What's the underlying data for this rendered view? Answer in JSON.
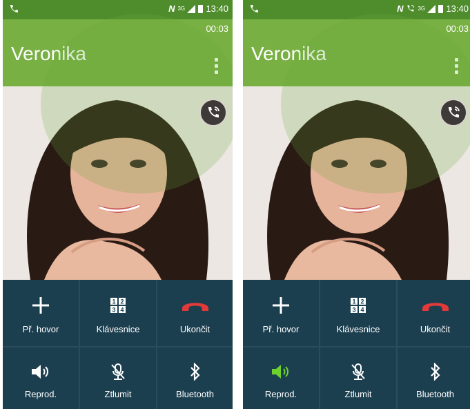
{
  "screens": [
    {
      "status": {
        "time": "13:40",
        "nfc": "N",
        "network": "3G"
      },
      "contact_name": "Veronika",
      "call_timer": "00:03",
      "buttons": {
        "add_call": "Př. hovor",
        "keypad": "Klávesnice",
        "end_call": "Ukončit",
        "speaker": "Reprod.",
        "mute": "Ztlumit",
        "bluetooth": "Bluetooth"
      },
      "speaker_on": false
    },
    {
      "status": {
        "time": "13:40",
        "nfc": "N",
        "network": "3G"
      },
      "contact_name": "Veronika",
      "call_timer": "00:03",
      "buttons": {
        "add_call": "Př. hovor",
        "keypad": "Klávesnice",
        "end_call": "Ukončit",
        "speaker": "Reprod.",
        "mute": "Ztlumit",
        "bluetooth": "Bluetooth"
      },
      "speaker_on": true
    }
  ],
  "icons": {
    "add_call": "plus-icon",
    "keypad": "keypad-icon",
    "end_call": "hang-up-icon",
    "speaker": "speaker-icon",
    "mute": "mute-mic-icon",
    "bluetooth": "bluetooth-icon",
    "handoff": "call-handoff-icon",
    "menu": "more-options-icon"
  },
  "colors": {
    "status_bar": "#4f8d2c",
    "header": "#78b043",
    "button_bg": "#1c3f50",
    "end_call": "#e03a3a",
    "speaker_active": "#6fd12e"
  }
}
